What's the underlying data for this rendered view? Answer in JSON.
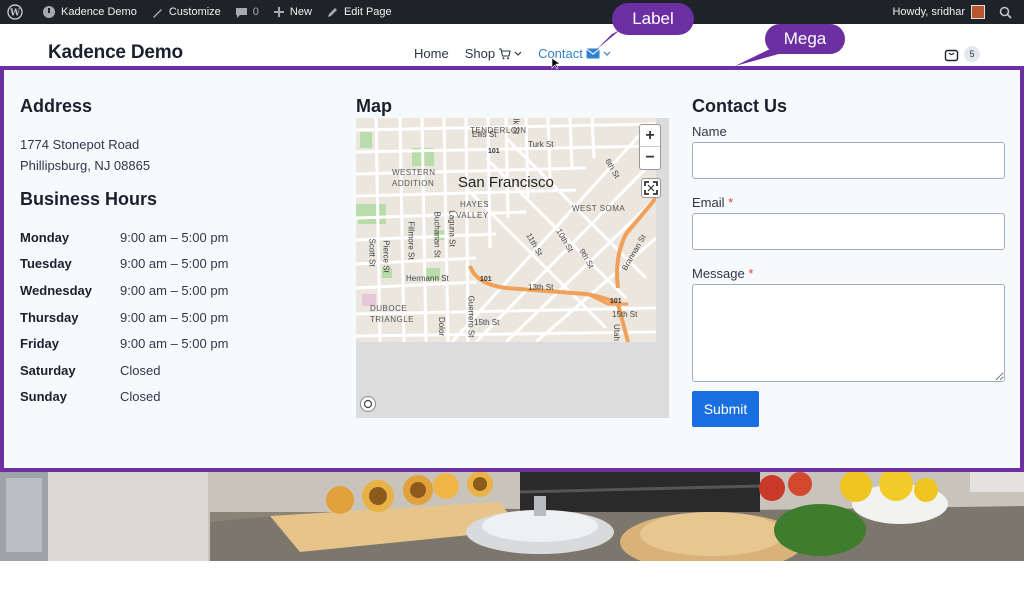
{
  "adminbar": {
    "site_name": "Kadence Demo",
    "customize": "Customize",
    "comments_count": "0",
    "new": "New",
    "edit_page": "Edit Page",
    "greeting": "Howdy, sridhar",
    "bg_color": "#1d2327"
  },
  "header": {
    "site_title": "Kadence Demo",
    "nav": {
      "home": "Home",
      "shop": "Shop",
      "contact": "Contact"
    },
    "cart_count": "5"
  },
  "callouts": {
    "label": "Label",
    "mega": "Mega",
    "color": "#6b2fa3"
  },
  "mega": {
    "address": {
      "heading": "Address",
      "line1": "1774 Stonepot Road",
      "line2": "Phillipsburg, NJ 08865"
    },
    "hours": {
      "heading": "Business Hours",
      "rows": [
        {
          "day": "Monday",
          "time": "9:00 am – 5:00 pm"
        },
        {
          "day": "Tuesday",
          "time": "9:00 am – 5:00 pm"
        },
        {
          "day": "Wednesday",
          "time": "9:00 am – 5:00 pm"
        },
        {
          "day": "Thursday",
          "time": "9:00 am – 5:00 pm"
        },
        {
          "day": "Friday",
          "time": "9:00 am – 5:00 pm"
        },
        {
          "day": "Saturday",
          "time": "Closed"
        },
        {
          "day": "Sunday",
          "time": "Closed"
        }
      ]
    },
    "map": {
      "heading": "Map",
      "labels": {
        "city": "San Francisco",
        "tenderloin": "TENDERLOIN",
        "western_addition_1": "WESTERN",
        "western_addition_2": "ADDITION",
        "hayes_valley_1": "HAYES",
        "hayes_valley_2": "VALLEY",
        "west_soma": "WEST SOMA",
        "duboce_1": "DUBOCE",
        "duboce_2": "TRIANGLE",
        "ellis": "Ellis St",
        "turk": "Turk St",
        "hwy_101_a": "101",
        "hwy_101_b": "101",
        "hwy_101_c": "101",
        "sixth": "6th St",
        "tenth": "10th St",
        "eleventh": "11th St",
        "ninth": "9th St",
        "thirteenth": "13th St",
        "fifteenth_a": "15th St",
        "fifteenth_b": "15th St",
        "hermann": "Hermann St",
        "scott": "Scott St",
        "pierce": "Pierce St",
        "fillmore": "Fillmore St",
        "buchanan": "Buchanan St",
        "laguna": "Laguna St",
        "guerrero": "Guerrero St",
        "dolores": "Dolor",
        "brannan": "Brannan St",
        "utah": "Utah",
        "polk": "lk St"
      },
      "zoom_in": "+",
      "zoom_out": "−"
    },
    "contact": {
      "heading": "Contact Us",
      "name_label": "Name",
      "email_label": "Email",
      "message_label": "Message",
      "required_mark": "*",
      "submit": "Submit"
    }
  }
}
